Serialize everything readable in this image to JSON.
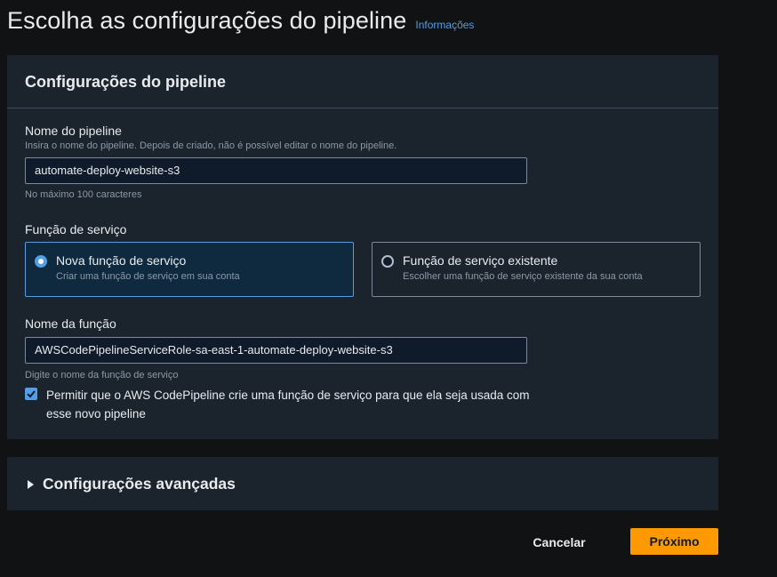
{
  "page": {
    "title": "Escolha as configurações do pipeline",
    "info_link": "Informações"
  },
  "pipeline_settings": {
    "title": "Configurações do pipeline",
    "pipeline_name": {
      "label": "Nome do pipeline",
      "description": "Insira o nome do pipeline. Depois de criado, não é possível editar o nome do pipeline.",
      "value": "automate-deploy-website-s3",
      "constraint": "No máximo 100 caracteres"
    },
    "service_role": {
      "label": "Função de serviço",
      "options": [
        {
          "title": "Nova função de serviço",
          "description": "Criar uma função de serviço em sua conta",
          "selected": true
        },
        {
          "title": "Função de serviço existente",
          "description": "Escolher uma função de serviço existente da sua conta",
          "selected": false
        }
      ]
    },
    "role_name": {
      "label": "Nome da função",
      "value": "AWSCodePipelineServiceRole-sa-east-1-automate-deploy-website-s3",
      "description": "Digite o nome da função de serviço"
    },
    "allow_checkbox": {
      "checked": true,
      "label": "Permitir que o AWS CodePipeline crie uma função de serviço para que ela seja usada com esse novo pipeline"
    }
  },
  "advanced": {
    "title": "Configurações avançadas",
    "expanded": false
  },
  "footer": {
    "cancel_label": "Cancelar",
    "next_label": "Próximo"
  },
  "colors": {
    "accent": "#539fe5",
    "primary_button": "#ff9900",
    "panel_bg": "#1b232d"
  }
}
